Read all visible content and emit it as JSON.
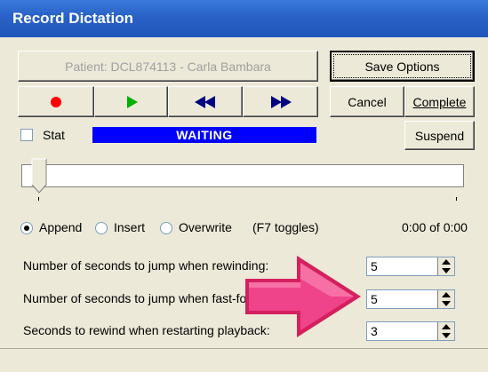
{
  "window": {
    "title": "Record Dictation"
  },
  "patient_label": "Patient: DCL874113 - Carla Bambara",
  "buttons": {
    "save_options": "Save Options",
    "cancel": "Cancel",
    "complete": "Complete",
    "suspend": "Suspend"
  },
  "stat_label": "Stat",
  "status": "WAITING",
  "modes": {
    "append": "Append",
    "insert": "Insert",
    "overwrite": "Overwrite",
    "hint": "(F7 toggles)",
    "selected": "append"
  },
  "time_readout": "0:00 of 0:00",
  "settings": [
    {
      "label": "Number of seconds to jump when rewinding:",
      "value": "5"
    },
    {
      "label": "Number of seconds to jump when fast-forwarding:",
      "value": "5"
    },
    {
      "label": "Seconds to rewind when restarting playback:",
      "value": "3"
    }
  ],
  "icons": {
    "record": "record-icon",
    "play": "play-icon",
    "rewind": "rewind-icon",
    "fast_forward": "fast-forward-icon",
    "pointer": "pointer-arrow-icon"
  },
  "colors": {
    "title_bar": "#2a63c8",
    "status_bg": "#0000ff",
    "record": "#ff0000",
    "play": "#00b000",
    "transport": "#000080",
    "pointer": "#e8337a"
  }
}
